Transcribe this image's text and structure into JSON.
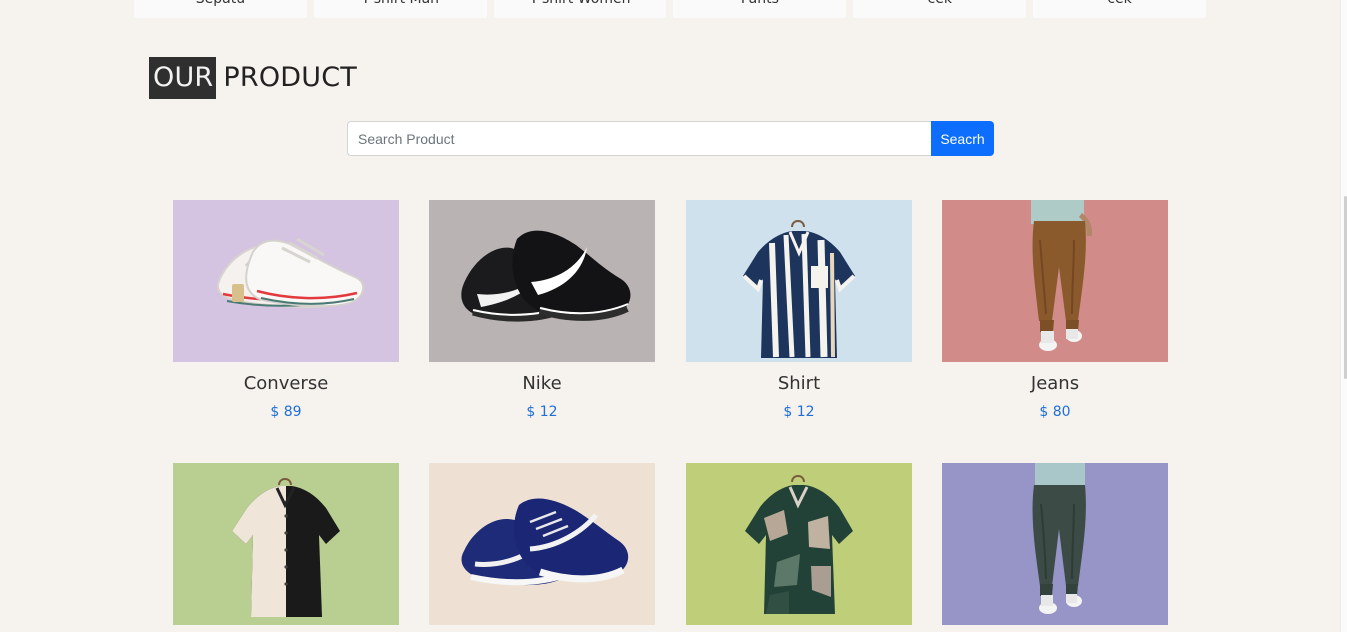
{
  "categories": [
    {
      "label": "Sepatu"
    },
    {
      "label": "T-shirt Man"
    },
    {
      "label": "T-shirt Women"
    },
    {
      "label": "Pants"
    },
    {
      "label": "cek"
    },
    {
      "label": "cek"
    }
  ],
  "section": {
    "title_highlight": "OUR",
    "title_rest": "PRODUCT"
  },
  "search": {
    "placeholder": "Search Product",
    "button_label": "Seacrh"
  },
  "products": [
    {
      "name": "Converse",
      "price": "$ 89",
      "icon": "sneaker-icon",
      "bg": "#d4c3e1"
    },
    {
      "name": "Nike",
      "price": "$ 12",
      "icon": "running-shoes-icon",
      "bg": "#bab3b3"
    },
    {
      "name": "Shirt",
      "price": "$ 12",
      "icon": "shirt-icon",
      "bg": "#cfe1ed"
    },
    {
      "name": "Jeans",
      "price": "$ 80",
      "icon": "trousers-icon",
      "bg": "#d18c89"
    },
    {
      "name": "",
      "price": "",
      "icon": "shirt-icon",
      "bg": "#b9cf91"
    },
    {
      "name": "",
      "price": "",
      "icon": "sneaker-icon",
      "bg": "#eee1d4"
    },
    {
      "name": "",
      "price": "",
      "icon": "shirt-icon",
      "bg": "#bfce79"
    },
    {
      "name": "",
      "price": "",
      "icon": "trousers-icon",
      "bg": "#9795c8"
    }
  ]
}
